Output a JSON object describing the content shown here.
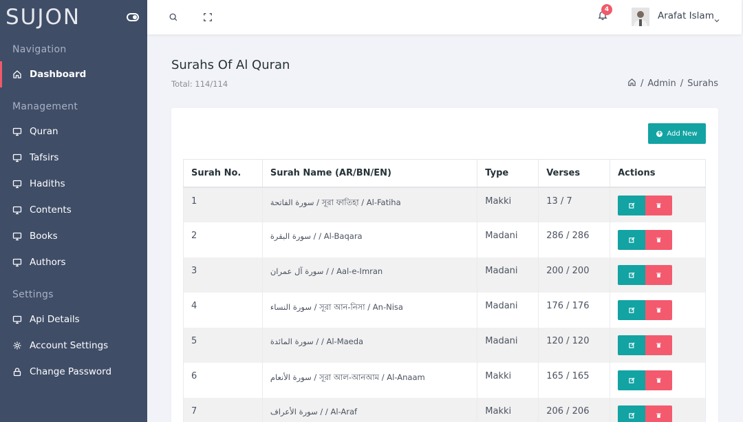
{
  "brand": "SUJON",
  "sidebar": {
    "sections": [
      {
        "caption": "Navigation",
        "items": [
          {
            "label": "Dashboard",
            "icon": "home-icon",
            "active": true
          }
        ]
      },
      {
        "caption": "Management",
        "items": [
          {
            "label": "Quran",
            "icon": "monitor-icon"
          },
          {
            "label": "Tafsirs",
            "icon": "monitor-icon"
          },
          {
            "label": "Hadiths",
            "icon": "monitor-icon"
          },
          {
            "label": "Contents",
            "icon": "monitor-icon"
          },
          {
            "label": "Books",
            "icon": "monitor-icon"
          },
          {
            "label": "Authors",
            "icon": "monitor-icon"
          }
        ]
      },
      {
        "caption": "Settings",
        "items": [
          {
            "label": "Api Details",
            "icon": "monitor-icon"
          },
          {
            "label": "Account Settings",
            "icon": "gear-icon"
          },
          {
            "label": "Change Password",
            "icon": "lock-icon"
          }
        ]
      }
    ]
  },
  "header": {
    "notification_count": "4",
    "user_name": "Arafat Islam"
  },
  "page": {
    "title": "Surahs Of Al Quran",
    "subtitle": "Total: 114/114",
    "breadcrumb": [
      "Admin",
      "Surahs"
    ],
    "add_button": "Add New"
  },
  "table": {
    "headers": [
      "Surah No.",
      "Surah Name (AR/BN/EN)",
      "Type",
      "Verses",
      "Actions"
    ],
    "rows": [
      {
        "no": "1",
        "name": "سورة الفاتحة / সূরা ফাতিহা / Al-Fatiha",
        "type": "Makki",
        "verses": "13 / 7"
      },
      {
        "no": "2",
        "name": "سورة البقرة / / Al-Baqara",
        "type": "Madani",
        "verses": "286 / 286"
      },
      {
        "no": "3",
        "name": "سورة آل عمران / / Aal-e-Imran",
        "type": "Madani",
        "verses": "200 / 200"
      },
      {
        "no": "4",
        "name": "سورة النساء / সূরা আন-নিসা / An-Nisa",
        "type": "Madani",
        "verses": "176 / 176"
      },
      {
        "no": "5",
        "name": "سورة المائدة / / Al-Maeda",
        "type": "Madani",
        "verses": "120 / 120"
      },
      {
        "no": "6",
        "name": "سورة الأنعام / সূরা আল-আনআম / Al-Anaam",
        "type": "Makki",
        "verses": "165 / 165"
      },
      {
        "no": "7",
        "name": "سورة الأعراف / / Al-Araf",
        "type": "Makki",
        "verses": "206 / 206"
      }
    ]
  },
  "colors": {
    "sidebar": "#3f4d67",
    "accent": "#13a3a3",
    "danger": "#f35a6e"
  }
}
